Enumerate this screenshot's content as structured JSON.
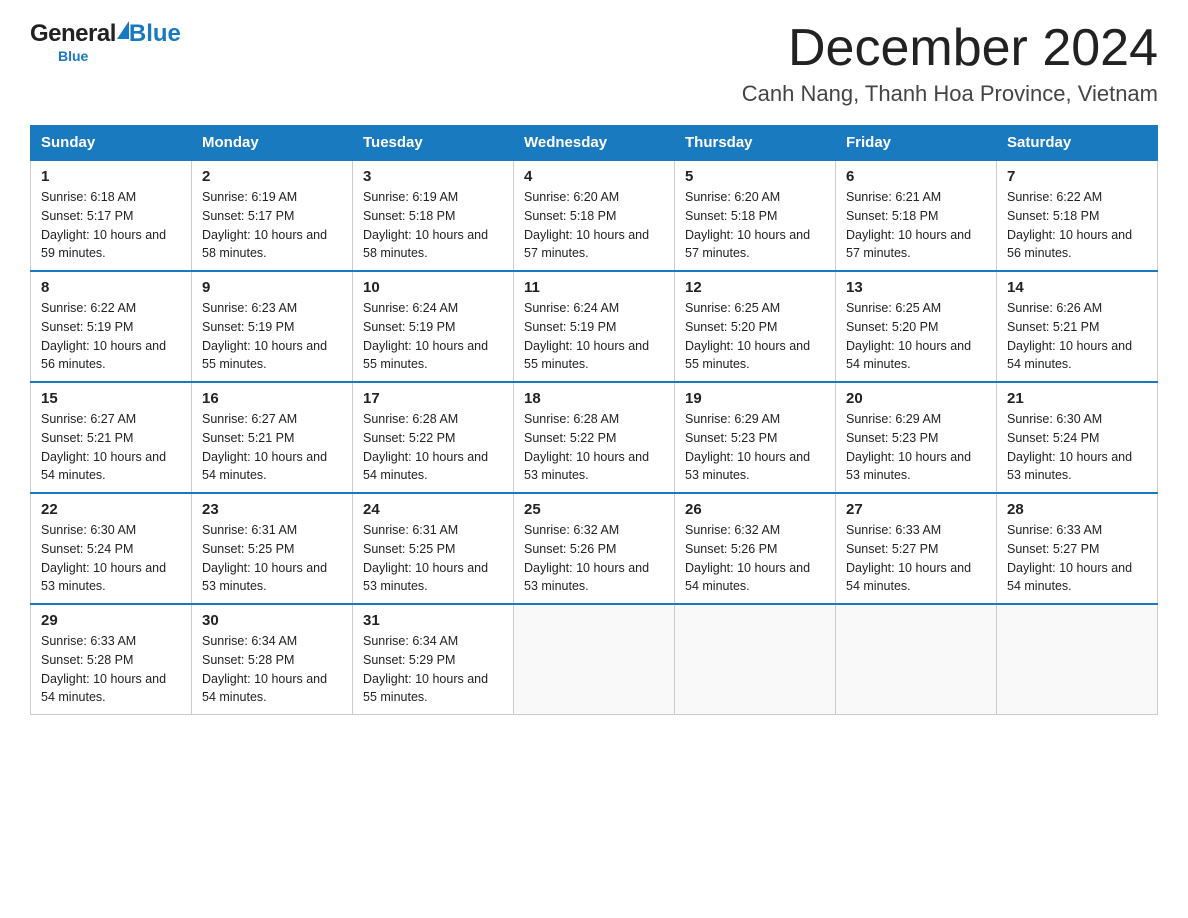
{
  "header": {
    "logo_general": "General",
    "logo_blue": "Blue",
    "month_title": "December 2024",
    "location": "Canh Nang, Thanh Hoa Province, Vietnam"
  },
  "calendar": {
    "days_of_week": [
      "Sunday",
      "Monday",
      "Tuesday",
      "Wednesday",
      "Thursday",
      "Friday",
      "Saturday"
    ],
    "weeks": [
      [
        {
          "day": "1",
          "sunrise": "6:18 AM",
          "sunset": "5:17 PM",
          "daylight": "10 hours and 59 minutes."
        },
        {
          "day": "2",
          "sunrise": "6:19 AM",
          "sunset": "5:17 PM",
          "daylight": "10 hours and 58 minutes."
        },
        {
          "day": "3",
          "sunrise": "6:19 AM",
          "sunset": "5:18 PM",
          "daylight": "10 hours and 58 minutes."
        },
        {
          "day": "4",
          "sunrise": "6:20 AM",
          "sunset": "5:18 PM",
          "daylight": "10 hours and 57 minutes."
        },
        {
          "day": "5",
          "sunrise": "6:20 AM",
          "sunset": "5:18 PM",
          "daylight": "10 hours and 57 minutes."
        },
        {
          "day": "6",
          "sunrise": "6:21 AM",
          "sunset": "5:18 PM",
          "daylight": "10 hours and 57 minutes."
        },
        {
          "day": "7",
          "sunrise": "6:22 AM",
          "sunset": "5:18 PM",
          "daylight": "10 hours and 56 minutes."
        }
      ],
      [
        {
          "day": "8",
          "sunrise": "6:22 AM",
          "sunset": "5:19 PM",
          "daylight": "10 hours and 56 minutes."
        },
        {
          "day": "9",
          "sunrise": "6:23 AM",
          "sunset": "5:19 PM",
          "daylight": "10 hours and 55 minutes."
        },
        {
          "day": "10",
          "sunrise": "6:24 AM",
          "sunset": "5:19 PM",
          "daylight": "10 hours and 55 minutes."
        },
        {
          "day": "11",
          "sunrise": "6:24 AM",
          "sunset": "5:19 PM",
          "daylight": "10 hours and 55 minutes."
        },
        {
          "day": "12",
          "sunrise": "6:25 AM",
          "sunset": "5:20 PM",
          "daylight": "10 hours and 55 minutes."
        },
        {
          "day": "13",
          "sunrise": "6:25 AM",
          "sunset": "5:20 PM",
          "daylight": "10 hours and 54 minutes."
        },
        {
          "day": "14",
          "sunrise": "6:26 AM",
          "sunset": "5:21 PM",
          "daylight": "10 hours and 54 minutes."
        }
      ],
      [
        {
          "day": "15",
          "sunrise": "6:27 AM",
          "sunset": "5:21 PM",
          "daylight": "10 hours and 54 minutes."
        },
        {
          "day": "16",
          "sunrise": "6:27 AM",
          "sunset": "5:21 PM",
          "daylight": "10 hours and 54 minutes."
        },
        {
          "day": "17",
          "sunrise": "6:28 AM",
          "sunset": "5:22 PM",
          "daylight": "10 hours and 54 minutes."
        },
        {
          "day": "18",
          "sunrise": "6:28 AM",
          "sunset": "5:22 PM",
          "daylight": "10 hours and 53 minutes."
        },
        {
          "day": "19",
          "sunrise": "6:29 AM",
          "sunset": "5:23 PM",
          "daylight": "10 hours and 53 minutes."
        },
        {
          "day": "20",
          "sunrise": "6:29 AM",
          "sunset": "5:23 PM",
          "daylight": "10 hours and 53 minutes."
        },
        {
          "day": "21",
          "sunrise": "6:30 AM",
          "sunset": "5:24 PM",
          "daylight": "10 hours and 53 minutes."
        }
      ],
      [
        {
          "day": "22",
          "sunrise": "6:30 AM",
          "sunset": "5:24 PM",
          "daylight": "10 hours and 53 minutes."
        },
        {
          "day": "23",
          "sunrise": "6:31 AM",
          "sunset": "5:25 PM",
          "daylight": "10 hours and 53 minutes."
        },
        {
          "day": "24",
          "sunrise": "6:31 AM",
          "sunset": "5:25 PM",
          "daylight": "10 hours and 53 minutes."
        },
        {
          "day": "25",
          "sunrise": "6:32 AM",
          "sunset": "5:26 PM",
          "daylight": "10 hours and 53 minutes."
        },
        {
          "day": "26",
          "sunrise": "6:32 AM",
          "sunset": "5:26 PM",
          "daylight": "10 hours and 54 minutes."
        },
        {
          "day": "27",
          "sunrise": "6:33 AM",
          "sunset": "5:27 PM",
          "daylight": "10 hours and 54 minutes."
        },
        {
          "day": "28",
          "sunrise": "6:33 AM",
          "sunset": "5:27 PM",
          "daylight": "10 hours and 54 minutes."
        }
      ],
      [
        {
          "day": "29",
          "sunrise": "6:33 AM",
          "sunset": "5:28 PM",
          "daylight": "10 hours and 54 minutes."
        },
        {
          "day": "30",
          "sunrise": "6:34 AM",
          "sunset": "5:28 PM",
          "daylight": "10 hours and 54 minutes."
        },
        {
          "day": "31",
          "sunrise": "6:34 AM",
          "sunset": "5:29 PM",
          "daylight": "10 hours and 55 minutes."
        },
        null,
        null,
        null,
        null
      ]
    ]
  }
}
